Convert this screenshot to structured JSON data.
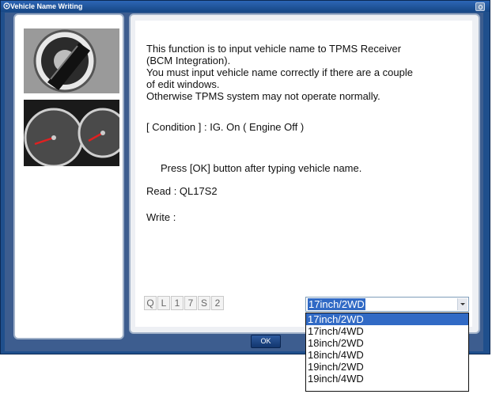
{
  "window": {
    "title": "Vehicle Name Writing"
  },
  "info": {
    "lines": [
      "This function is to input vehicle name to TPMS Receiver",
      "(BCM Integration).",
      "You must input vehicle name correctly if there are a couple",
      "of edit windows.",
      "Otherwise TPMS system may not operate normally."
    ],
    "condition": "[ Condition ] : IG. On ( Engine Off )",
    "instruction": "Press [OK] button after typing vehicle name.",
    "read_label": "Read : QL17S2",
    "write_label": "Write :"
  },
  "input": {
    "chars": [
      "Q",
      "L",
      "1",
      "7",
      "S",
      "2"
    ]
  },
  "combo": {
    "selected": "17inch/2WD",
    "options": [
      "17inch/2WD",
      "17inch/4WD",
      "18inch/2WD",
      "18inch/4WD",
      "19inch/2WD",
      "19inch/4WD"
    ]
  },
  "buttons": {
    "ok": "OK"
  },
  "colors": {
    "titlebar": "#1f4f8c",
    "selection": "#316ac5"
  }
}
